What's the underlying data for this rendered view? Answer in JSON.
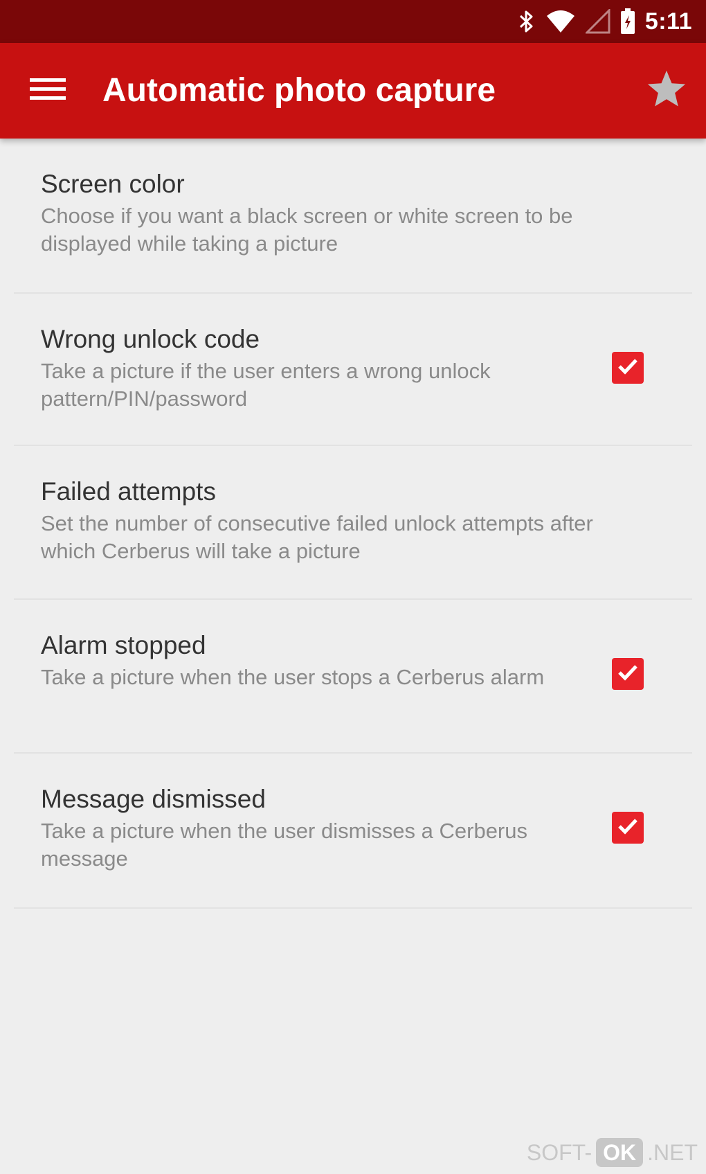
{
  "status_bar": {
    "time": "5:11",
    "icons": [
      "bluetooth-icon",
      "wifi-icon",
      "cell-signal-icon",
      "battery-icon"
    ]
  },
  "app_bar": {
    "title": "Automatic photo capture",
    "menu_icon": "hamburger-menu-icon",
    "action_icon": "star-icon",
    "color": "#c71111",
    "status_color": "#7a0708"
  },
  "settings": [
    {
      "title": "Screen color",
      "description": "Choose if you want a black screen or white screen to be displayed while taking a picture",
      "checkbox": false
    },
    {
      "title": "Wrong unlock code",
      "description": "Take a picture if the user enters a wrong unlock pattern/PIN/password",
      "checkbox": true,
      "checked": true
    },
    {
      "title": "Failed attempts",
      "description": "Set the number of consecutive failed unlock attempts after which Cerberus will take a picture",
      "checkbox": false
    },
    {
      "title": "Alarm stopped",
      "description": "Take a picture when the user stops a Cerberus alarm",
      "checkbox": true,
      "checked": true
    },
    {
      "title": "Message dismissed",
      "description": "Take a picture when the user dismisses a Cerberus message",
      "checkbox": true,
      "checked": true
    }
  ],
  "accent_color": "#e8232a",
  "watermark": {
    "left": "SOFT-",
    "badge": "OK",
    "right": ".NET"
  }
}
